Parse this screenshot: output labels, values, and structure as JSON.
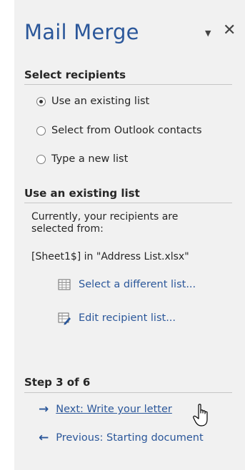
{
  "pane": {
    "title": "Mail Merge"
  },
  "select_recipients": {
    "heading": "Select recipients",
    "options": [
      {
        "label": "Use an existing list",
        "selected": true
      },
      {
        "label": "Select from Outlook contacts",
        "selected": false
      },
      {
        "label": "Type a new list",
        "selected": false
      }
    ]
  },
  "existing_list": {
    "heading": "Use an existing list",
    "current_line1": "Currently, your recipients are",
    "current_line2": "selected from:",
    "source": "[Sheet1$] in \"Address List.xlsx\"",
    "select_different": "Select a different list...",
    "edit_list": "Edit recipient list..."
  },
  "steps": {
    "heading": "Step 3 of 6",
    "next": "Next: Write your letter",
    "previous": "Previous: Starting document"
  },
  "colors": {
    "accent": "#2b579a",
    "pane_bg": "#f1f1f1"
  }
}
